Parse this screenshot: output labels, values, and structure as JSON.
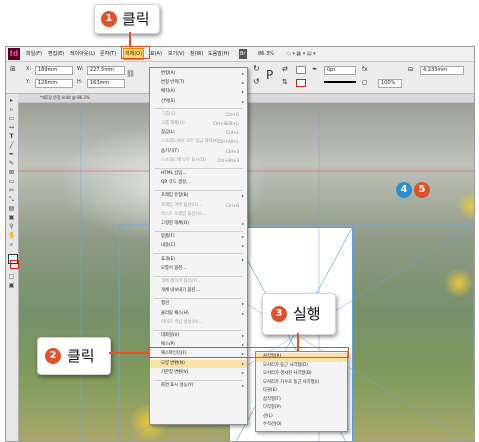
{
  "menubar": {
    "logo": "Id",
    "items": [
      "파일(F)",
      "편집(E)",
      "레이아웃(L)",
      "문자(T)",
      "개체(O)",
      "표(A)",
      "보기(V)",
      "창(W)",
      "도움말(H)"
    ],
    "br": "Br",
    "zoom": "86.3%"
  },
  "toolbar": {
    "x_label": "X:",
    "x_value": "189mm",
    "y_label": "Y:",
    "y_value": "126mm",
    "w_label": "W:",
    "w_value": "227.5mm",
    "h_label": "H:",
    "h_value": "163mm",
    "stroke_weight": "0pt",
    "opacity": "100%",
    "width_right": "4.233mm"
  },
  "document_tab": "*제1장.문장.indd @ 86.3%",
  "object_menu": {
    "items": [
      {
        "label": "변형(A)",
        "arrow": "▸",
        "state": "enabled"
      },
      {
        "label": "변형 반복(T)",
        "arrow": "▸",
        "state": "enabled"
      },
      {
        "label": "배치(A)",
        "arrow": "▸",
        "state": "enabled"
      },
      {
        "label": "선택(S)",
        "arrow": "▸",
        "state": "enabled"
      },
      {
        "label": "그룹(G)",
        "shortcut": "Ctrl+G",
        "state": "disabled"
      },
      {
        "label": "그룹 해제(U)",
        "shortcut": "Ctrl+Shift+G",
        "state": "disabled"
      },
      {
        "label": "잠금(L)",
        "shortcut": "Ctrl+L",
        "state": "enabled"
      },
      {
        "label": "스프레드에서 모두 잠금 해제(K)",
        "shortcut": "Ctrl+Alt+L",
        "state": "disabled"
      },
      {
        "label": "숨기기(T)",
        "shortcut": "Ctrl+3",
        "state": "enabled"
      },
      {
        "label": "스프레드에 모두 표시(D)",
        "shortcut": "Ctrl+Alt+3",
        "state": "disabled"
      },
      {
        "label": "HTML 삽입...",
        "state": "enabled"
      },
      {
        "label": "QR 코드 생성...",
        "state": "enabled"
      },
      {
        "label": "프레임 유형(B)",
        "arrow": "▸",
        "state": "enabled"
      },
      {
        "label": "프레임 여백 옵션(O)...",
        "shortcut": "Ctrl+B",
        "state": "disabled"
      },
      {
        "label": "텍스트 프레임 옵션(X)...",
        "state": "disabled"
      },
      {
        "label": "고정된 개체(O)",
        "arrow": "▸",
        "state": "enabled"
      },
      {
        "label": "맞춤(F)",
        "arrow": "▸",
        "state": "enabled"
      },
      {
        "label": "내용(C)",
        "arrow": "▸",
        "state": "enabled"
      },
      {
        "label": "효과(E)",
        "arrow": "▸",
        "state": "enabled"
      },
      {
        "label": "모퉁이 옵션...",
        "state": "enabled"
      },
      {
        "label": "개체 레이어 옵션(Y)...",
        "state": "disabled"
      },
      {
        "label": "개체 내보내기 옵션...",
        "state": "enabled"
      },
      {
        "label": "캡션",
        "arrow": "▸",
        "state": "enabled"
      },
      {
        "label": "클리핑 패스(H)",
        "arrow": "▸",
        "state": "enabled"
      },
      {
        "label": "이미지 색상 설정(M)...",
        "state": "disabled"
      },
      {
        "label": "대화형(V)",
        "arrow": "▸",
        "state": "enabled"
      },
      {
        "label": "패스(P)",
        "arrow": "▸",
        "state": "enabled"
      },
      {
        "label": "패스파인더(F)",
        "arrow": "▸",
        "state": "enabled"
      },
      {
        "label": "모양 변환(N)",
        "arrow": "▸",
        "state": "highlighted"
      },
      {
        "label": "기본점 변환(V)",
        "arrow": "▸",
        "state": "enabled"
      },
      {
        "label": "화면 표시 성능(Y)",
        "arrow": "▸",
        "state": "enabled"
      }
    ]
  },
  "convert_shape_submenu": {
    "items": [
      "사각형(R)",
      "모서리가 둥근 사각형(D)",
      "모서리가 경사진 사각형(B)",
      "모서리가 거꾸로 둥근 사각형(I)",
      "타원(E)",
      "삼각형(T)",
      "다각형(P)",
      "선(L)",
      "수직선(O)"
    ],
    "highlighted_index": 0
  },
  "callouts": {
    "step1": {
      "number": "1",
      "text": "클릭"
    },
    "step2": {
      "number": "2",
      "text": "클릭"
    },
    "step3": {
      "number": "3",
      "text": "실행"
    },
    "badge4": "4",
    "badge5": "5"
  },
  "colors": {
    "callout_red": "#e2502a",
    "badge_blue": "#2d8fd0",
    "menu_highlight": "#fbe1a6",
    "frame_blue": "#5aa0e0"
  }
}
